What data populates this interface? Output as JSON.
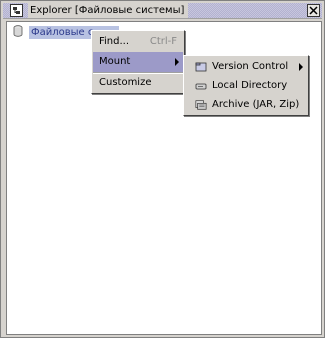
{
  "window": {
    "title": "Explorer [Файловые системы]"
  },
  "tree": {
    "root_label": "Файловые с..."
  },
  "context_menu": {
    "items": [
      {
        "label": "Find...",
        "shortcut": "Ctrl-F"
      },
      {
        "label": "Mount"
      },
      {
        "label": "Customize"
      }
    ]
  },
  "mount_submenu": {
    "items": [
      {
        "label": "Version Control",
        "icon": "folder-icon"
      },
      {
        "label": "Local Directory",
        "icon": "drive-icon"
      },
      {
        "label": "Archive (JAR, Zip)",
        "icon": "archive-icon"
      }
    ]
  },
  "colors": {
    "panel_bg": "#d6d3ce",
    "menu_highlight": "#9c9ac8",
    "selection_bg": "#b8c2e2"
  }
}
